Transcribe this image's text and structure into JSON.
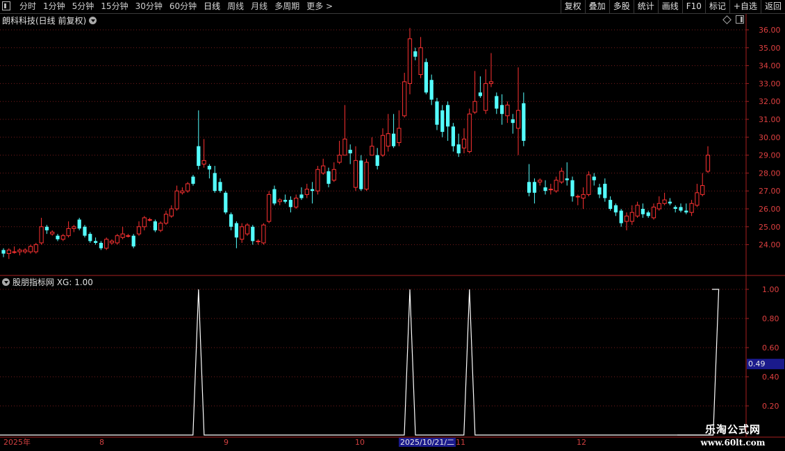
{
  "toolbar": {
    "tabs": [
      "分时",
      "1分钟",
      "5分钟",
      "15分钟",
      "30分钟",
      "60分钟",
      "日线",
      "周线",
      "月线",
      "多周期",
      "更多"
    ],
    "right_buttons": [
      "复权",
      "叠加",
      "多股",
      "统计",
      "画线",
      "F10",
      "标记",
      "+自选",
      "返回"
    ]
  },
  "chart_title": "朗科科技(日线 前复权)",
  "indicator_title": "股朋指标网 XG: 1.00",
  "price_axis": [
    "36.00",
    "35.00",
    "34.00",
    "33.00",
    "32.00",
    "31.00",
    "30.00",
    "29.00",
    "28.00",
    "27.00",
    "26.00",
    "25.00",
    "24.00"
  ],
  "indicator_axis": [
    "1.00",
    "0.80",
    "0.60",
    "0.40",
    "0.20"
  ],
  "indicator_cursor_value": "0.49",
  "date_axis": {
    "labels": [
      "2025年",
      "8",
      "9",
      "10",
      "11",
      "12"
    ],
    "selected": "2025/10/21/二"
  },
  "watermark": {
    "line1": "乐淘公式网",
    "line2": "www.60lt.com"
  },
  "colors": {
    "up": "#ff3232",
    "down": "#54ffff",
    "grid": "#7a1c1c",
    "axis": "#a82020",
    "signal": "#ffffff"
  },
  "chart_data": {
    "type": "candlestick",
    "price_range": [
      23.0,
      36.5
    ],
    "candles": [
      [
        23.7,
        23.5,
        23.8,
        23.3
      ],
      [
        23.5,
        23.7,
        23.8,
        23.2
      ],
      [
        23.6,
        23.6,
        23.9,
        23.5
      ],
      [
        23.6,
        23.7,
        23.8,
        23.4
      ],
      [
        23.6,
        23.7,
        23.8,
        23.5
      ],
      [
        23.6,
        23.9,
        24.0,
        23.5
      ],
      [
        23.6,
        24.0,
        24.1,
        23.5
      ],
      [
        24.1,
        25.0,
        25.5,
        24.0
      ],
      [
        25.0,
        24.8,
        25.1,
        24.6
      ],
      [
        24.6,
        24.7,
        24.8,
        24.5
      ],
      [
        24.5,
        24.3,
        24.6,
        24.2
      ],
      [
        24.3,
        24.5,
        24.6,
        24.2
      ],
      [
        24.5,
        24.9,
        25.3,
        24.4
      ],
      [
        24.9,
        25.0,
        25.1,
        24.7
      ],
      [
        25.4,
        24.9,
        25.5,
        24.8
      ],
      [
        25.0,
        24.5,
        25.1,
        24.4
      ],
      [
        24.6,
        24.2,
        24.7,
        24.1
      ],
      [
        24.2,
        24.1,
        24.4,
        24.0
      ],
      [
        24.1,
        23.8,
        24.2,
        23.7
      ],
      [
        23.8,
        24.3,
        24.4,
        23.7
      ],
      [
        24.1,
        24.2,
        24.3,
        24.0
      ],
      [
        24.1,
        24.5,
        24.6,
        24.0
      ],
      [
        24.4,
        24.6,
        25.0,
        24.3
      ],
      [
        24.5,
        24.5,
        24.6,
        24.4
      ],
      [
        24.5,
        23.9,
        24.6,
        23.8
      ],
      [
        24.6,
        25.0,
        25.3,
        24.5
      ],
      [
        25.0,
        25.5,
        25.6,
        24.8
      ],
      [
        25.4,
        25.4,
        25.5,
        25.3
      ],
      [
        25.3,
        24.8,
        25.4,
        24.7
      ],
      [
        24.8,
        25.2,
        25.3,
        24.7
      ],
      [
        25.2,
        25.7,
        25.9,
        25.1
      ],
      [
        25.6,
        26.0,
        26.2,
        25.5
      ],
      [
        26.0,
        27.0,
        27.3,
        25.9
      ],
      [
        26.9,
        27.0,
        27.2,
        26.8
      ],
      [
        27.0,
        27.4,
        27.5,
        26.9
      ],
      [
        27.8,
        27.4,
        27.9,
        27.3
      ],
      [
        29.5,
        28.4,
        31.5,
        28.2
      ],
      [
        28.5,
        28.7,
        29.9,
        28.3
      ],
      [
        28.4,
        28.2,
        28.5,
        27.7
      ],
      [
        28.0,
        27.0,
        28.4,
        26.9
      ],
      [
        27.5,
        27.0,
        27.7,
        26.9
      ],
      [
        26.9,
        25.8,
        27.0,
        25.7
      ],
      [
        25.7,
        25.0,
        25.8,
        24.8
      ],
      [
        25.2,
        24.4,
        25.3,
        23.8
      ],
      [
        24.3,
        25.0,
        25.2,
        24.1
      ],
      [
        24.6,
        25.1,
        25.2,
        24.5
      ],
      [
        25.0,
        24.2,
        25.1,
        24.0
      ],
      [
        24.2,
        24.2,
        24.3,
        24.0
      ],
      [
        24.1,
        25.1,
        25.2,
        24.0
      ],
      [
        25.3,
        26.8,
        27.0,
        25.2
      ],
      [
        27.1,
        26.3,
        27.3,
        26.2
      ],
      [
        26.4,
        26.5,
        26.6,
        26.2
      ],
      [
        26.5,
        26.4,
        26.8,
        26.3
      ],
      [
        26.5,
        26.1,
        26.7,
        25.8
      ],
      [
        26.1,
        26.6,
        26.8,
        26.0
      ],
      [
        26.8,
        26.6,
        27.2,
        26.5
      ],
      [
        26.8,
        27.1,
        27.4,
        26.6
      ],
      [
        27.1,
        27.0,
        27.5,
        26.3
      ],
      [
        27.0,
        28.2,
        28.4,
        26.8
      ],
      [
        28.0,
        28.4,
        28.8,
        27.9
      ],
      [
        28.1,
        27.4,
        28.3,
        27.2
      ],
      [
        27.6,
        28.2,
        28.6,
        27.5
      ],
      [
        28.6,
        29.0,
        29.8,
        28.5
      ],
      [
        29.0,
        29.9,
        31.8,
        29.0
      ],
      [
        29.3,
        29.1,
        29.6,
        28.5
      ],
      [
        27.2,
        28.7,
        29.5,
        27.0
      ],
      [
        28.7,
        27.1,
        29.0,
        27.0
      ],
      [
        27.1,
        28.6,
        28.8,
        27.0
      ],
      [
        29.0,
        29.5,
        30.0,
        29.0
      ],
      [
        29.0,
        28.4,
        29.4,
        28.2
      ],
      [
        29.0,
        30.1,
        30.5,
        28.9
      ],
      [
        29.5,
        30.2,
        31.3,
        29.2
      ],
      [
        30.2,
        29.5,
        31.3,
        29.4
      ],
      [
        29.7,
        30.5,
        31.5,
        29.5
      ],
      [
        31.2,
        33.1,
        33.6,
        31.1
      ],
      [
        33.0,
        35.5,
        36.1,
        32.4
      ],
      [
        34.8,
        34.5,
        35.0,
        34.3
      ],
      [
        33.5,
        35.0,
        35.6,
        33.3
      ],
      [
        34.2,
        32.5,
        34.4,
        32.4
      ],
      [
        33.2,
        32.1,
        33.5,
        31.8
      ],
      [
        32.0,
        30.7,
        32.2,
        30.4
      ],
      [
        31.5,
        30.3,
        31.8,
        30.0
      ],
      [
        31.8,
        30.6,
        32.0,
        29.8
      ],
      [
        30.6,
        29.5,
        30.8,
        29.2
      ],
      [
        29.6,
        29.1,
        30.2,
        28.9
      ],
      [
        29.4,
        29.9,
        30.5,
        29.1
      ],
      [
        29.2,
        31.3,
        31.6,
        29.1
      ],
      [
        31.4,
        32.0,
        33.7,
        31.3
      ],
      [
        32.5,
        32.3,
        33.4,
        32.2
      ],
      [
        31.5,
        33.0,
        33.8,
        31.3
      ],
      [
        33.0,
        33.1,
        34.7,
        32.8
      ],
      [
        32.3,
        31.6,
        32.5,
        31.3
      ],
      [
        31.8,
        31.3,
        32.4,
        30.7
      ],
      [
        31.2,
        31.8,
        32.0,
        30.8
      ],
      [
        31.0,
        30.8,
        31.3,
        30.2
      ],
      [
        30.5,
        31.5,
        33.9,
        29.0
      ],
      [
        31.9,
        29.8,
        32.5,
        29.5
      ],
      [
        27.5,
        26.9,
        28.5,
        26.7
      ],
      [
        27.5,
        26.9,
        27.7,
        26.3
      ],
      [
        27.5,
        27.6,
        27.7,
        27.3
      ],
      [
        27.2,
        27.0,
        27.6,
        26.8
      ],
      [
        27.1,
        27.1,
        27.4,
        26.8
      ],
      [
        27.0,
        27.6,
        27.8,
        26.9
      ],
      [
        27.5,
        28.1,
        28.3,
        27.4
      ],
      [
        27.7,
        27.6,
        28.6,
        27.3
      ],
      [
        27.6,
        26.7,
        27.8,
        26.4
      ],
      [
        26.7,
        26.7,
        26.8,
        26.2
      ],
      [
        26.6,
        26.8,
        27.2,
        26.0
      ],
      [
        26.8,
        27.9,
        28.1,
        26.7
      ],
      [
        27.8,
        27.6,
        28.0,
        27.3
      ],
      [
        27.2,
        26.8,
        27.4,
        26.6
      ],
      [
        27.4,
        26.6,
        27.7,
        26.4
      ],
      [
        26.5,
        26.0,
        26.7,
        25.9
      ],
      [
        26.2,
        25.8,
        26.3,
        25.6
      ],
      [
        25.9,
        25.2,
        26.0,
        25.0
      ],
      [
        25.3,
        25.6,
        25.8,
        24.8
      ],
      [
        25.3,
        25.8,
        26.2,
        25.1
      ],
      [
        25.6,
        26.2,
        26.4,
        25.5
      ],
      [
        26.0,
        25.7,
        26.3,
        25.5
      ],
      [
        25.8,
        25.6,
        25.9,
        25.5
      ],
      [
        25.5,
        26.1,
        26.3,
        25.4
      ],
      [
        26.0,
        26.3,
        26.7,
        25.9
      ],
      [
        26.3,
        26.5,
        26.9,
        26.2
      ],
      [
        26.4,
        26.3,
        26.6,
        26.2
      ],
      [
        26.1,
        26.0,
        26.2,
        25.8
      ],
      [
        26.1,
        25.9,
        26.3,
        25.8
      ],
      [
        25.9,
        25.8,
        26.3,
        25.7
      ],
      [
        25.8,
        26.3,
        26.5,
        25.6
      ],
      [
        26.2,
        26.9,
        27.4,
        26.1
      ],
      [
        26.8,
        27.3,
        28.0,
        26.7
      ],
      [
        28.1,
        29.0,
        29.5,
        28.0
      ]
    ],
    "indicator": {
      "name": "XG",
      "value_range": [
        0,
        1.0
      ],
      "signal_candle_indices": [
        36,
        75,
        86,
        132
      ]
    }
  }
}
